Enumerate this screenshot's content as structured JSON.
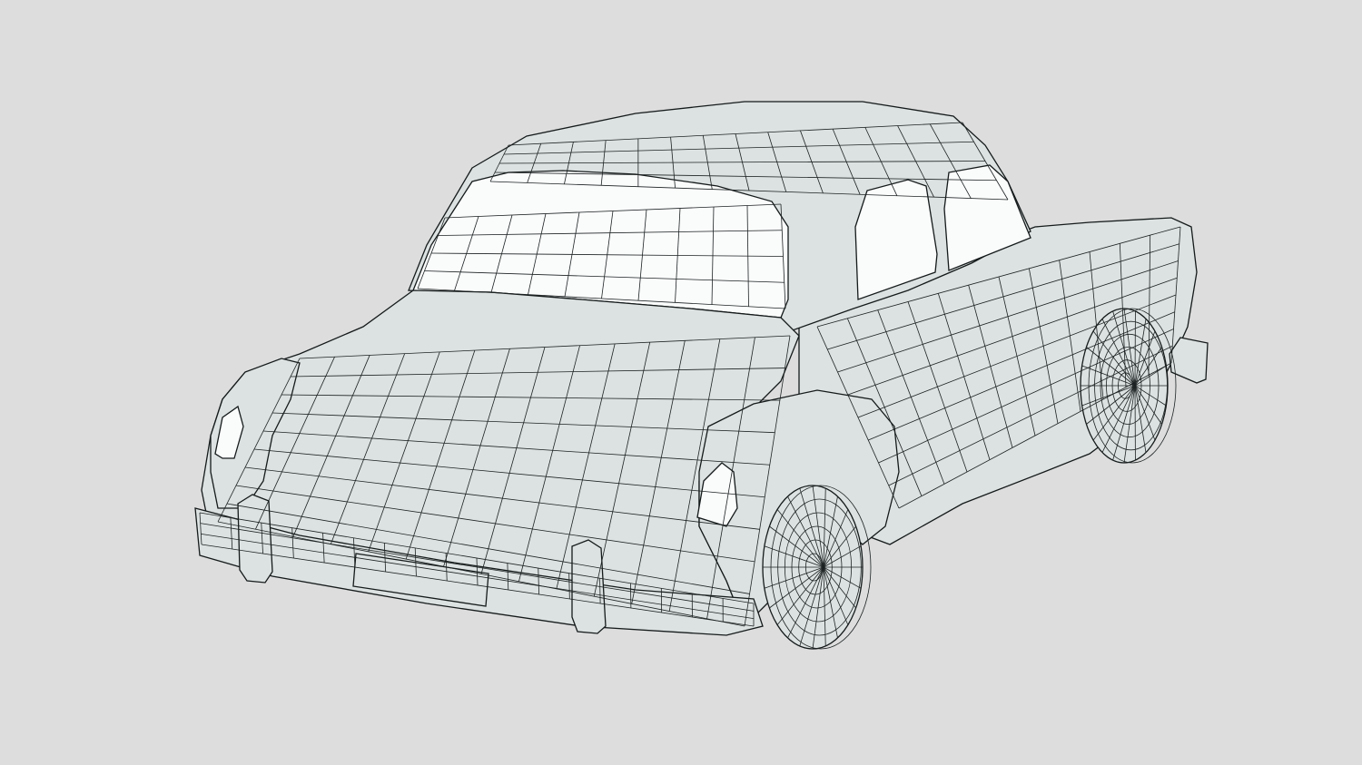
{
  "scene": {
    "subject": "wireframe-car-model",
    "colors": {
      "background": "#dddddd",
      "surface": "#dce1e1",
      "wire": "#1d2223",
      "glass": "#fafbfb"
    }
  }
}
